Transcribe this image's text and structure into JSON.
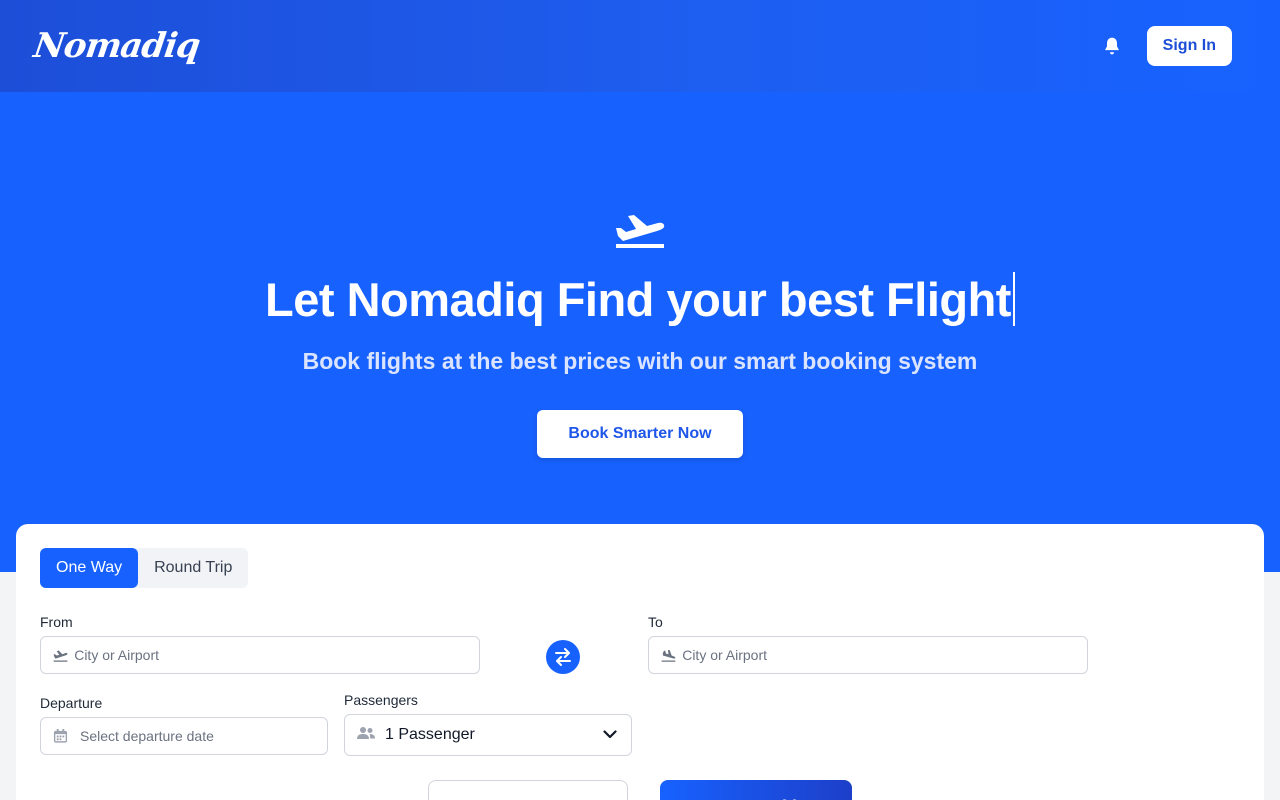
{
  "header": {
    "logo_text": "Nomadiq",
    "signin_label": "Sign In"
  },
  "hero": {
    "title": "Let Nomadiq Find your best Flight",
    "subtitle": "Book flights at the best prices with our smart booking system",
    "cta_label": "Book Smarter Now"
  },
  "search": {
    "trip_types": [
      "One Way",
      "Round Trip"
    ],
    "active_trip_type": "One Way",
    "from_label": "From",
    "from_placeholder": "City or Airport",
    "to_label": "To",
    "to_placeholder": "City or Airport",
    "departure_label": "Departure",
    "departure_placeholder": "Select departure date",
    "passengers_label": "Passengers",
    "passengers_value": "1 Passenger",
    "primary_button_label": "Smart Booking"
  },
  "icons": {
    "bell": "bell-icon",
    "plane": "plane-takeoff-icon",
    "swap": "swap-icon",
    "calendar": "calendar-icon",
    "users": "users-icon",
    "chevron": "chevron-down-icon"
  },
  "colors": {
    "brand": "#1762ff",
    "header_dark": "#1d4ed8"
  }
}
